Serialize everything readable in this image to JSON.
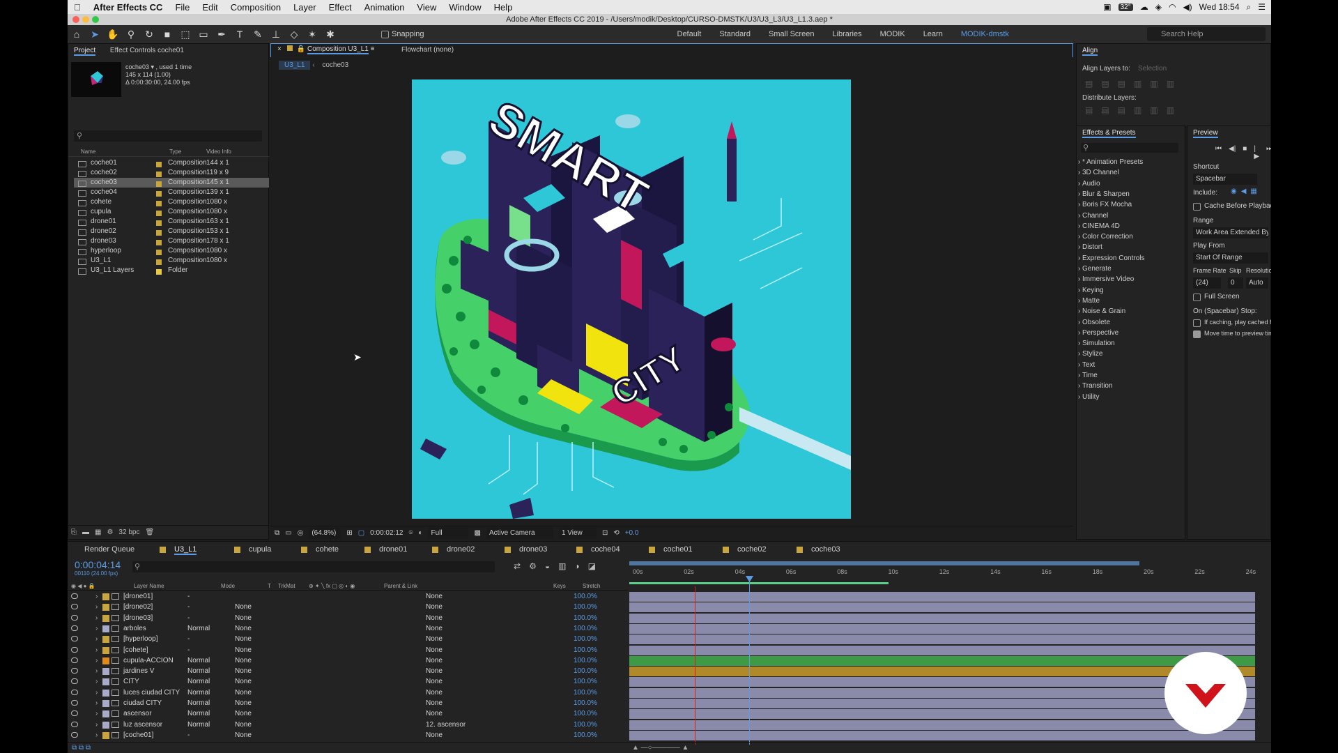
{
  "menubar": {
    "app": "After Effects CC",
    "items": [
      "File",
      "Edit",
      "Composition",
      "Layer",
      "Effect",
      "Animation",
      "View",
      "Window",
      "Help"
    ],
    "clock": "Wed 18:54",
    "badge": "32°"
  },
  "window": {
    "title": "Adobe After Effects CC 2019 - /Users/modik/Desktop/CURSO-DMSTK/U3/U3_L3/U3_L1.3.aep *"
  },
  "toolbar": {
    "snapping": "Snapping",
    "workspaces": [
      "Default",
      "Standard",
      "Small Screen",
      "Libraries",
      "MODIK",
      "Learn",
      "MODIK-dmstk"
    ],
    "search": "Search Help"
  },
  "project": {
    "tabs": [
      "Project",
      "Effect Controls coche01"
    ],
    "info_name": "coche03 ▾ , used 1 time",
    "info_size": "145 x 114 (1.00)",
    "info_dur": "Δ 0:00:30:00, 24.00 fps",
    "search": "",
    "headers": {
      "name": "Name",
      "type": "Type",
      "video": "Video Info"
    },
    "items": [
      {
        "name": "coche01",
        "type": "Composition",
        "video": "144 x 1",
        "color": "#c8a63d"
      },
      {
        "name": "coche02",
        "type": "Composition",
        "video": "119 x 9",
        "color": "#c8a63d"
      },
      {
        "name": "coche03",
        "type": "Composition",
        "video": "145 x 1",
        "color": "#c8a63d",
        "selected": true
      },
      {
        "name": "coche04",
        "type": "Composition",
        "video": "139 x 1",
        "color": "#c8a63d"
      },
      {
        "name": "cohete",
        "type": "Composition",
        "video": "1080 x",
        "color": "#c8a63d"
      },
      {
        "name": "cupula",
        "type": "Composition",
        "video": "1080 x",
        "color": "#c8a63d"
      },
      {
        "name": "drone01",
        "type": "Composition",
        "video": "163 x 1",
        "color": "#c8a63d"
      },
      {
        "name": "drone02",
        "type": "Composition",
        "video": "153 x 1",
        "color": "#c8a63d"
      },
      {
        "name": "drone03",
        "type": "Composition",
        "video": "178 x 1",
        "color": "#c8a63d"
      },
      {
        "name": "hyperloop",
        "type": "Composition",
        "video": "1080 x",
        "color": "#c8a63d"
      },
      {
        "name": "U3_L1",
        "type": "Composition",
        "video": "1080 x",
        "color": "#c8a63d"
      },
      {
        "name": "U3_L1 Layers",
        "type": "Folder",
        "video": "",
        "color": "#e8c94a"
      }
    ],
    "bpc": "32 bpc"
  },
  "comp": {
    "tab": "Composition U3_L1",
    "flowchart": "Flowchart (none)",
    "crumbs": [
      "U3_L1",
      "coche03"
    ],
    "zoom": "(64.8%)",
    "time": "0:00:02:12",
    "res": "Full",
    "camera": "Active Camera",
    "views": "1 View",
    "exposure": "+0.0",
    "art": {
      "word1": "SMART",
      "word2": "CITY"
    }
  },
  "align": {
    "title": "Align",
    "align_to_label": "Align Layers to:",
    "align_to": "Selection",
    "distribute": "Distribute Layers:"
  },
  "effects": {
    "title": "Effects & Presets",
    "search": "",
    "categories": [
      "* Animation Presets",
      "3D Channel",
      "Audio",
      "Blur & Sharpen",
      "Boris FX Mocha",
      "Channel",
      "CINEMA 4D",
      "Color Correction",
      "Distort",
      "Expression Controls",
      "Generate",
      "Immersive Video",
      "Keying",
      "Matte",
      "Noise & Grain",
      "Obsolete",
      "Perspective",
      "Simulation",
      "Stylize",
      "Text",
      "Time",
      "Transition",
      "Utility"
    ]
  },
  "preview": {
    "title": "Preview",
    "shortcut_label": "Shortcut",
    "shortcut": "Spacebar",
    "include": "Include:",
    "cache": "Cache Before Playback",
    "range_label": "Range",
    "range": "Work Area Extended By Current ...",
    "playfrom_label": "Play From",
    "playfrom": "Start Of Range",
    "framerate_label": "Frame Rate",
    "skip_label": "Skip",
    "resolution_label": "Resolution",
    "framerate": "(24)",
    "skip": "0",
    "resolution": "Auto",
    "fullscreen": "Full Screen",
    "onstop": "On (Spacebar) Stop:",
    "ifcaching": "If caching, play cached frames",
    "movetime": "Move time to preview time"
  },
  "timeline": {
    "tabs": [
      "Render Queue",
      "U3_L1",
      "cupula",
      "cohete",
      "drone01",
      "drone02",
      "drone03",
      "coche04",
      "coche01",
      "coche02",
      "coche03"
    ],
    "time": "0:00:04:14",
    "frames": "00110 (24.00 fps)",
    "headers": {
      "layer": "Layer Name",
      "mode": "Mode",
      "t": "T",
      "trkmat": "TrkMat",
      "parent": "Parent & Link",
      "keys": "Keys",
      "stretch": "Stretch"
    },
    "ruler": [
      "00s",
      "02s",
      "04s",
      "06s",
      "08s",
      "10s",
      "12s",
      "14s",
      "16s",
      "18s",
      "20s",
      "22s",
      "24s"
    ],
    "layers": [
      {
        "name": "[drone01]",
        "mode": "-",
        "trk": "",
        "parent": "None",
        "stretch": "100.0%",
        "color": "#c8a63d",
        "bar": "#8a8aab"
      },
      {
        "name": "[drone02]",
        "mode": "-",
        "trk": "None",
        "parent": "None",
        "stretch": "100.0%",
        "color": "#c8a63d",
        "bar": "#8a8aab"
      },
      {
        "name": "[drone03]",
        "mode": "-",
        "trk": "None",
        "parent": "None",
        "stretch": "100.0%",
        "color": "#c8a63d",
        "bar": "#8a8aab"
      },
      {
        "name": "arboles",
        "mode": "Normal",
        "trk": "None",
        "parent": "None",
        "stretch": "100.0%",
        "color": "#a9a9c9",
        "bar": "#8a8aab"
      },
      {
        "name": "[hyperloop]",
        "mode": "-",
        "trk": "None",
        "parent": "None",
        "stretch": "100.0%",
        "color": "#c8a63d",
        "bar": "#8a8aab"
      },
      {
        "name": "[cohete]",
        "mode": "-",
        "trk": "None",
        "parent": "None",
        "stretch": "100.0%",
        "color": "#c8a63d",
        "bar": "#8a8aab"
      },
      {
        "name": "cupula-ACCION",
        "mode": "Normal",
        "trk": "None",
        "parent": "None",
        "stretch": "100.0%",
        "color": "#e08a1a",
        "bar": "#3f9a45"
      },
      {
        "name": "jardines V",
        "mode": "Normal",
        "trk": "None",
        "parent": "None",
        "stretch": "100.0%",
        "color": "#a9a9c9",
        "bar": "#b08a2a"
      },
      {
        "name": "CITY",
        "mode": "Normal",
        "trk": "None",
        "parent": "None",
        "stretch": "100.0%",
        "color": "#a9a9c9",
        "bar": "#8a8aab"
      },
      {
        "name": "luces ciudad CITY",
        "mode": "Normal",
        "trk": "None",
        "parent": "None",
        "stretch": "100.0%",
        "color": "#a9a9c9",
        "bar": "#8a8aab"
      },
      {
        "name": "ciudad CITY",
        "mode": "Normal",
        "trk": "None",
        "parent": "None",
        "stretch": "100.0%",
        "color": "#a9a9c9",
        "bar": "#8a8aab"
      },
      {
        "name": "ascensor",
        "mode": "Normal",
        "trk": "None",
        "parent": "None",
        "stretch": "100.0%",
        "color": "#a9a9c9",
        "bar": "#8a8aab"
      },
      {
        "name": "luz ascensor",
        "mode": "Normal",
        "trk": "None",
        "parent": "12. ascensor",
        "stretch": "100.0%",
        "color": "#a9a9c9",
        "bar": "#8a8aab"
      },
      {
        "name": "[coche01]",
        "mode": "-",
        "trk": "None",
        "parent": "None",
        "stretch": "100.0%",
        "color": "#c8a63d",
        "bar": "#8a8aab"
      }
    ]
  }
}
